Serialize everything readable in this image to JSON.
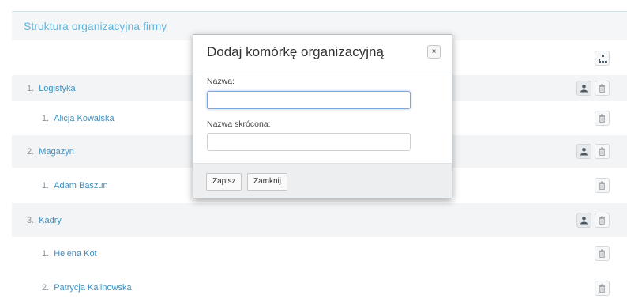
{
  "panel": {
    "title": "Struktura organizacyjna firmy"
  },
  "tree": [
    {
      "num": "1.",
      "name": "Logistyka",
      "level": 1,
      "actions": [
        "user",
        "trash"
      ]
    },
    {
      "num": "1.",
      "name": "Alicja Kowalska",
      "level": 2,
      "actions": [
        "trash"
      ]
    },
    {
      "num": "2.",
      "name": "Magazyn",
      "level": 1,
      "actions": [
        "user",
        "trash"
      ]
    },
    {
      "num": "1.",
      "name": "Adam Baszun",
      "level": 2,
      "actions": [
        "trash"
      ]
    },
    {
      "num": "3.",
      "name": "Kadry",
      "level": 1,
      "actions": [
        "user",
        "trash"
      ]
    },
    {
      "num": "1.",
      "name": "Helena Kot",
      "level": 2,
      "actions": [
        "trash"
      ]
    },
    {
      "num": "2.",
      "name": "Patrycja Kalinowska",
      "level": 2,
      "actions": [
        "trash"
      ]
    }
  ],
  "modal": {
    "title": "Dodaj komórkę organizacyjną",
    "close_label": "×",
    "name_label": "Nazwa:",
    "name_value": "",
    "short_label": "Nazwa skrócona:",
    "short_value": "",
    "save_label": "Zapisz",
    "close_button_label": "Zamknij"
  },
  "icons": {
    "add": "sitemap-icon",
    "user": "user-icon",
    "trash": "trash-icon"
  }
}
